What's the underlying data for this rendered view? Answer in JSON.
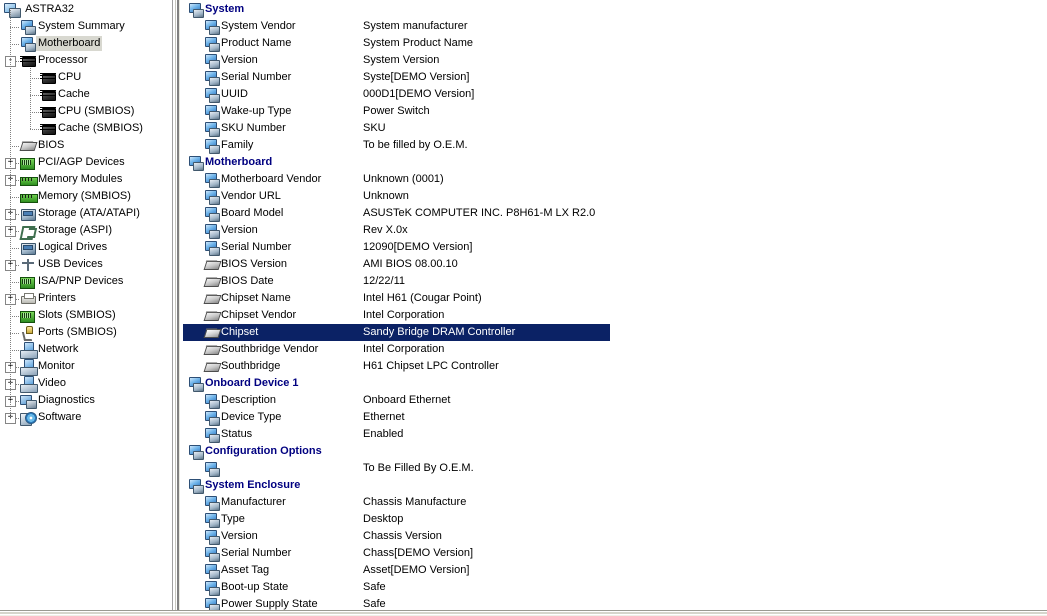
{
  "tree": {
    "root": {
      "label": "ASTRA32",
      "icon": "root-computer-icon"
    },
    "items": [
      {
        "label": "System Summary",
        "icon": "computer-icon",
        "depth": 1,
        "expander": "",
        "selected": false
      },
      {
        "label": "Motherboard",
        "icon": "computer-icon",
        "depth": 1,
        "expander": "",
        "selected": true
      },
      {
        "label": "Processor",
        "icon": "cpu-icon",
        "depth": 1,
        "expander": "-",
        "selected": false
      },
      {
        "label": "CPU",
        "icon": "cpu-icon",
        "depth": 2,
        "expander": "",
        "selected": false
      },
      {
        "label": "Cache",
        "icon": "cpu-icon",
        "depth": 2,
        "expander": "",
        "selected": false
      },
      {
        "label": "CPU (SMBIOS)",
        "icon": "cpu-icon",
        "depth": 2,
        "expander": "",
        "selected": false
      },
      {
        "label": "Cache (SMBIOS)",
        "icon": "cpu-icon",
        "depth": 2,
        "expander": "",
        "selected": false
      },
      {
        "label": "BIOS",
        "icon": "chip-icon",
        "depth": 1,
        "expander": "",
        "selected": false
      },
      {
        "label": "PCI/AGP Devices",
        "icon": "board-icon",
        "depth": 1,
        "expander": "+",
        "selected": false
      },
      {
        "label": "Memory Modules",
        "icon": "memory-icon",
        "depth": 1,
        "expander": "+",
        "selected": false
      },
      {
        "label": "Memory (SMBIOS)",
        "icon": "memory-icon",
        "depth": 1,
        "expander": "",
        "selected": false
      },
      {
        "label": "Storage (ATA/ATAPI)",
        "icon": "drive-icon",
        "depth": 1,
        "expander": "+",
        "selected": false
      },
      {
        "label": "Storage (ASPI)",
        "icon": "aspi-icon",
        "depth": 1,
        "expander": "+",
        "selected": false
      },
      {
        "label": "Logical Drives",
        "icon": "drive-icon",
        "depth": 1,
        "expander": "",
        "selected": false
      },
      {
        "label": "USB Devices",
        "icon": "usb-icon",
        "depth": 1,
        "expander": "+",
        "selected": false
      },
      {
        "label": "ISA/PNP Devices",
        "icon": "board-icon",
        "depth": 1,
        "expander": "",
        "selected": false
      },
      {
        "label": "Printers",
        "icon": "printer-icon",
        "depth": 1,
        "expander": "+",
        "selected": false
      },
      {
        "label": "Slots (SMBIOS)",
        "icon": "board-icon",
        "depth": 1,
        "expander": "",
        "selected": false
      },
      {
        "label": "Ports (SMBIOS)",
        "icon": "port-icon",
        "depth": 1,
        "expander": "",
        "selected": false
      },
      {
        "label": "Network",
        "icon": "network-icon",
        "depth": 1,
        "expander": "",
        "selected": false
      },
      {
        "label": "Monitor",
        "icon": "monitor-icon",
        "depth": 1,
        "expander": "+",
        "selected": false
      },
      {
        "label": "Video",
        "icon": "monitor-icon",
        "depth": 1,
        "expander": "+",
        "selected": false
      },
      {
        "label": "Diagnostics",
        "icon": "diagnostics-icon",
        "depth": 1,
        "expander": "+",
        "selected": false
      },
      {
        "label": "Software",
        "icon": "software-icon",
        "depth": 1,
        "expander": "+",
        "selected": false
      }
    ]
  },
  "detail": {
    "rows": [
      {
        "type": "header",
        "icon": "computer-icon",
        "name": "System",
        "value": ""
      },
      {
        "type": "child",
        "icon": "computer-icon",
        "name": "System Vendor",
        "value": "System manufacturer"
      },
      {
        "type": "child",
        "icon": "computer-icon",
        "name": "Product Name",
        "value": "System Product Name"
      },
      {
        "type": "child",
        "icon": "computer-icon",
        "name": "Version",
        "value": "System Version"
      },
      {
        "type": "child",
        "icon": "computer-icon",
        "name": "Serial Number",
        "value": "Syste[DEMO Version]"
      },
      {
        "type": "child",
        "icon": "computer-icon",
        "name": "UUID",
        "value": "000D1[DEMO Version]"
      },
      {
        "type": "child",
        "icon": "computer-icon",
        "name": "Wake-up Type",
        "value": "Power Switch"
      },
      {
        "type": "child",
        "icon": "computer-icon",
        "name": "SKU Number",
        "value": "SKU"
      },
      {
        "type": "child",
        "icon": "computer-icon",
        "name": "Family",
        "value": "To be filled by O.E.M."
      },
      {
        "type": "header",
        "icon": "computer-icon",
        "name": "Motherboard",
        "value": ""
      },
      {
        "type": "child",
        "icon": "computer-icon",
        "name": "Motherboard Vendor",
        "value": "Unknown (0001)"
      },
      {
        "type": "child",
        "icon": "computer-icon",
        "name": "Vendor URL",
        "value": "Unknown"
      },
      {
        "type": "child",
        "icon": "computer-icon",
        "name": "Board Model",
        "value": "ASUSTeK COMPUTER INC. P8H61-M LX R2.0"
      },
      {
        "type": "child",
        "icon": "computer-icon",
        "name": "Version",
        "value": "Rev X.0x"
      },
      {
        "type": "child",
        "icon": "computer-icon",
        "name": "Serial Number",
        "value": "12090[DEMO Version]"
      },
      {
        "type": "child",
        "icon": "chip-icon",
        "name": "BIOS Version",
        "value": "AMI BIOS 08.00.10"
      },
      {
        "type": "child",
        "icon": "chip-icon",
        "name": "BIOS Date",
        "value": "12/22/11"
      },
      {
        "type": "child",
        "icon": "chip-icon",
        "name": "Chipset Name",
        "value": "Intel H61 (Cougar Point)"
      },
      {
        "type": "child",
        "icon": "chip-icon",
        "name": "Chipset Vendor",
        "value": "Intel Corporation"
      },
      {
        "type": "child",
        "icon": "chip-icon",
        "name": "Chipset",
        "value": "Sandy Bridge DRAM Controller",
        "selected": true
      },
      {
        "type": "child",
        "icon": "chip-icon",
        "name": "Southbridge Vendor",
        "value": "Intel Corporation"
      },
      {
        "type": "child",
        "icon": "chip-icon",
        "name": "Southbridge",
        "value": "H61 Chipset LPC Controller"
      },
      {
        "type": "header",
        "icon": "computer-icon",
        "name": "Onboard Device 1",
        "value": ""
      },
      {
        "type": "child",
        "icon": "computer-icon",
        "name": "Description",
        "value": "Onboard Ethernet"
      },
      {
        "type": "child",
        "icon": "computer-icon",
        "name": "Device Type",
        "value": "Ethernet"
      },
      {
        "type": "child",
        "icon": "computer-icon",
        "name": "Status",
        "value": "Enabled"
      },
      {
        "type": "header",
        "icon": "computer-icon",
        "name": "Configuration Options",
        "value": ""
      },
      {
        "type": "child",
        "icon": "computer-icon",
        "name": "",
        "value": "To Be Filled By O.E.M."
      },
      {
        "type": "header",
        "icon": "computer-icon",
        "name": "System Enclosure",
        "value": ""
      },
      {
        "type": "child",
        "icon": "computer-icon",
        "name": "Manufacturer",
        "value": "Chassis Manufacture"
      },
      {
        "type": "child",
        "icon": "computer-icon",
        "name": "Type",
        "value": "Desktop"
      },
      {
        "type": "child",
        "icon": "computer-icon",
        "name": "Version",
        "value": "Chassis Version"
      },
      {
        "type": "child",
        "icon": "computer-icon",
        "name": "Serial Number",
        "value": "Chass[DEMO Version]"
      },
      {
        "type": "child",
        "icon": "computer-icon",
        "name": "Asset Tag",
        "value": "Asset[DEMO Version]"
      },
      {
        "type": "child",
        "icon": "computer-icon",
        "name": "Boot-up State",
        "value": "Safe"
      },
      {
        "type": "child",
        "icon": "computer-icon",
        "name": "Power Supply State",
        "value": "Safe"
      }
    ]
  },
  "colors": {
    "header_text": "#000080",
    "selection_bg": "#0b2265",
    "selection_fg": "#ffffff",
    "tree_selection_bg": "#d8d8d0",
    "background": "#ffffff"
  }
}
